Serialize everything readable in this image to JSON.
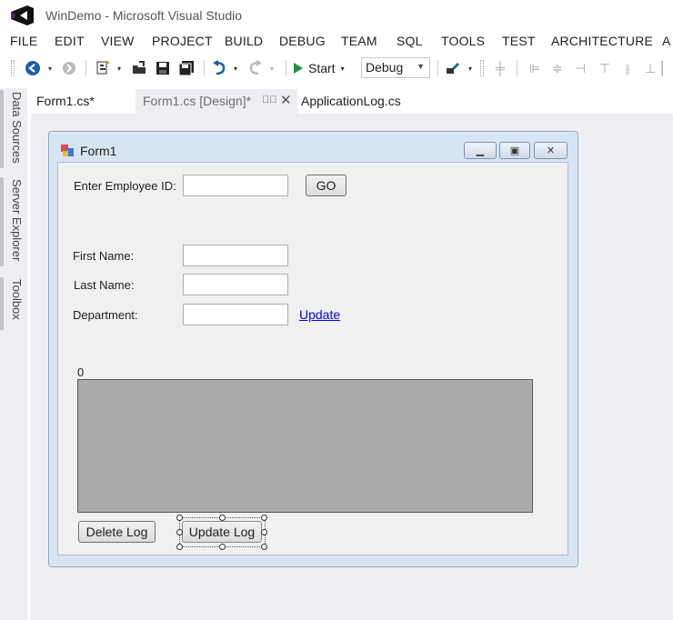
{
  "app": {
    "title": "WinDemo - Microsoft Visual Studio"
  },
  "menu": {
    "items": [
      "FILE",
      "EDIT",
      "VIEW",
      "PROJECT",
      "BUILD",
      "DEBUG",
      "TEAM",
      "SQL",
      "TOOLS",
      "TEST",
      "ARCHITECTURE",
      "A"
    ]
  },
  "toolbar": {
    "start_label": "Start",
    "config_value": "Debug",
    "icons": [
      "back-icon",
      "forward-icon",
      "new-project-icon",
      "open-file-icon",
      "save-icon",
      "save-all-icon",
      "undo-icon",
      "redo-icon",
      "start-icon",
      "attach-icon",
      "align-left-icon",
      "align-center-icon",
      "align-right-icon",
      "align-top-icon",
      "align-middle-icon",
      "align-bottom-icon"
    ]
  },
  "side_tabs": [
    "Data Sources",
    "Server Explorer",
    "Toolbox"
  ],
  "doc_tabs": [
    {
      "label": "Form1.cs*"
    },
    {
      "label": "Form1.cs [Design]*"
    },
    {
      "label": "ApplicationLog.cs"
    }
  ],
  "form": {
    "title": "Form1",
    "employee_id_label": "Enter Employee ID:",
    "go_label": "GO",
    "first_name_label": "First Name:",
    "last_name_label": "Last Name:",
    "department_label": "Department:",
    "update_link": "Update",
    "counter_label": "0",
    "delete_log_label": "Delete Log",
    "update_log_label": "Update Log",
    "employee_id_value": "",
    "first_name_value": "",
    "last_name_value": "",
    "department_value": ""
  },
  "colors": {
    "accent": "#68217a",
    "start_green": "#1e8f3a",
    "form_frame": "#d7e4f2",
    "grid_panel": "#ababab",
    "link": "#0000ff"
  }
}
